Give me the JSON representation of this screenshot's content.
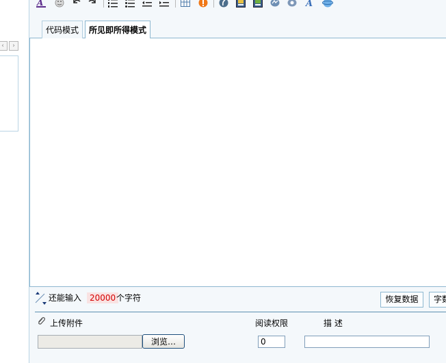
{
  "left": {
    "prev_glyph": "‹",
    "next_glyph": "›"
  },
  "toolbar": {
    "icons": [
      "font-color-icon",
      "emoticon-icon",
      "undo-icon",
      "redo-icon",
      "ordered-list-icon",
      "unordered-list-icon",
      "outdent-icon",
      "indent-icon",
      "table-icon",
      "info-icon",
      "flash-icon",
      "media-icon",
      "real-media-icon",
      "wmv-icon",
      "quicktime-icon",
      "text-style-icon",
      "globe-icon"
    ]
  },
  "tabs": [
    {
      "label": "代码模式",
      "active": false
    },
    {
      "label": "所见即所得模式",
      "active": true
    }
  ],
  "status": {
    "remain_prefix": "还能输入",
    "remain_count": "20000",
    "remain_suffix": "个字符",
    "restore_label": "恢复数据",
    "count_label": "字数检查"
  },
  "attachments": {
    "upload_label": "上传附件",
    "permission_label": "阅读权限",
    "description_label": "描 述",
    "browse_label": "浏览…",
    "permission_value": "0",
    "description_value": "",
    "file_value": ""
  },
  "colors": {
    "border_blue": "#8db7d0",
    "panel_bg": "#f4f8fb",
    "count_red": "#d40000",
    "count_bg": "#f9e2e2"
  }
}
